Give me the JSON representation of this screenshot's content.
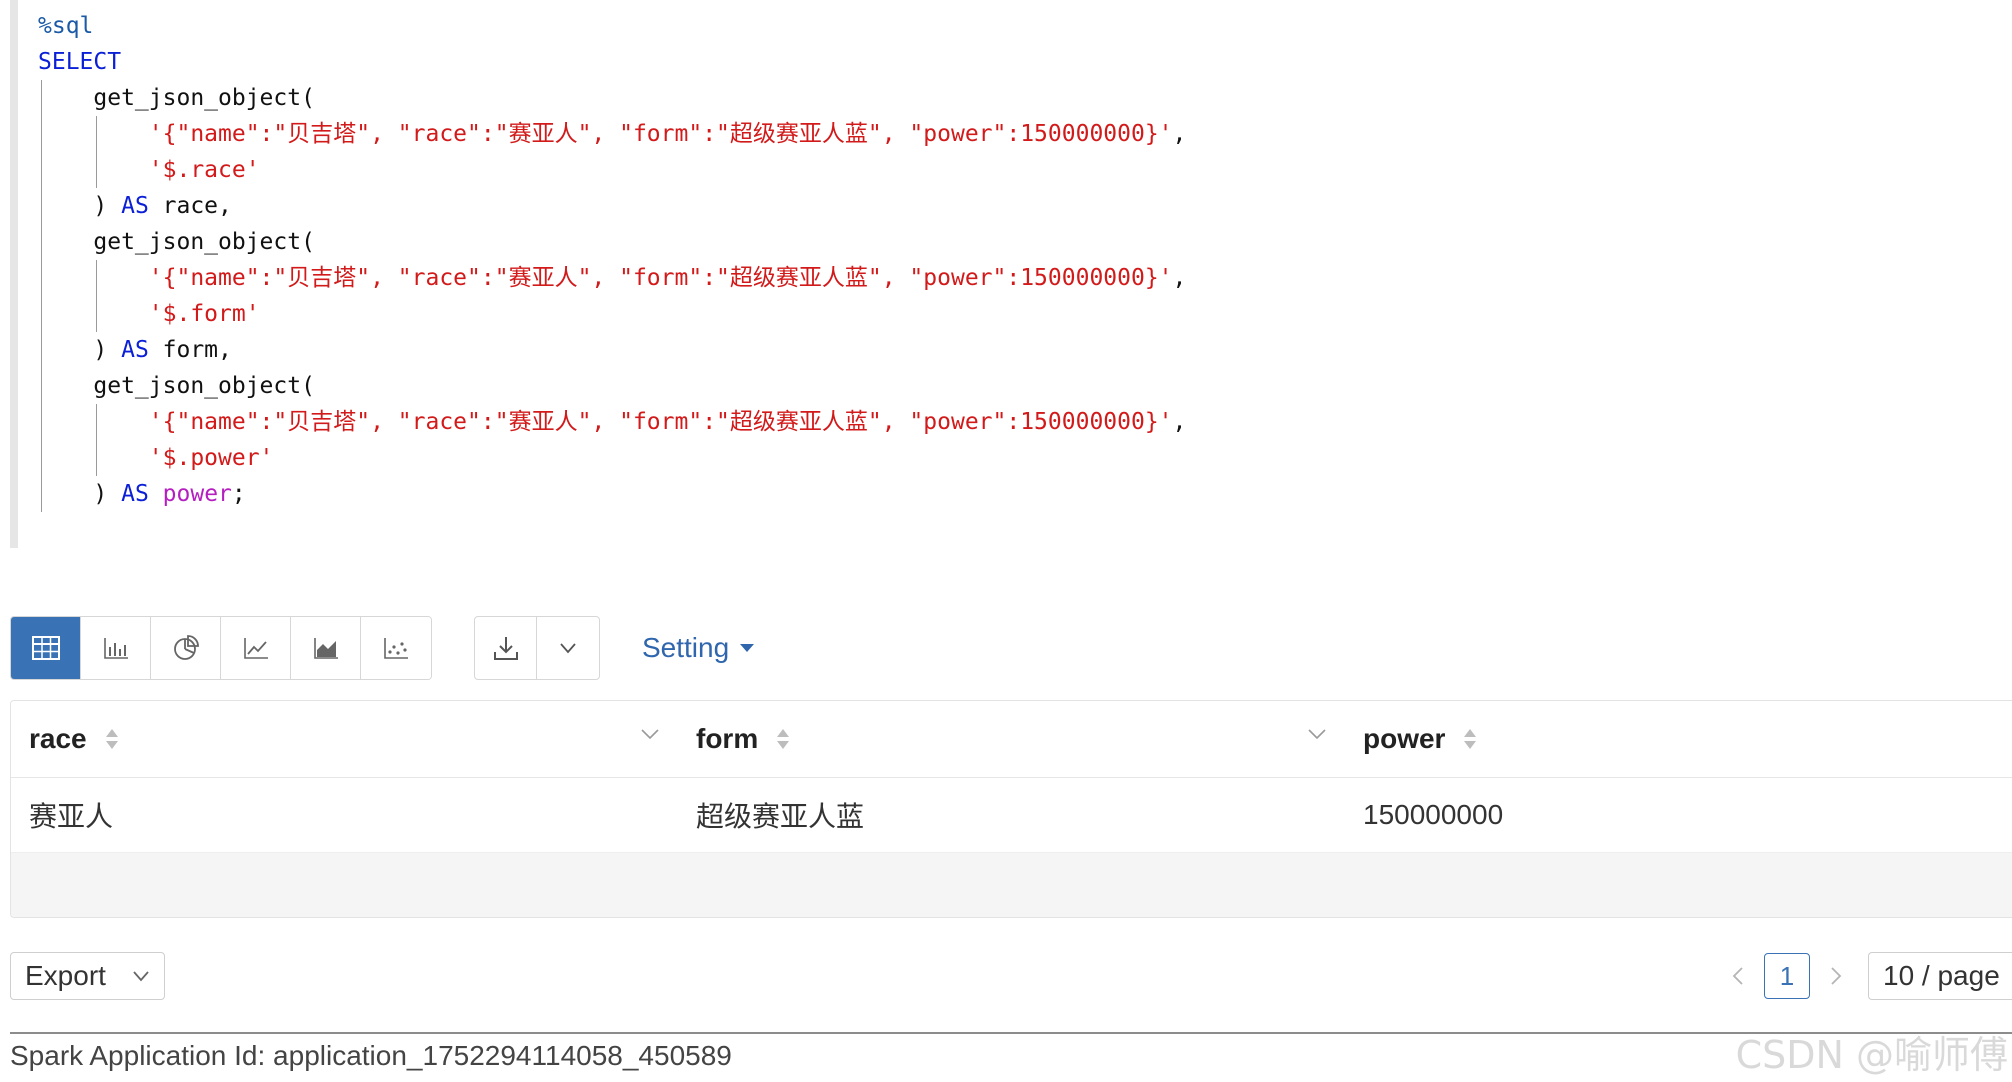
{
  "editor": {
    "lines": [
      [
        {
          "t": "magic",
          "v": "%sql"
        }
      ],
      [
        {
          "t": "kw",
          "v": "SELECT"
        }
      ],
      [
        {
          "t": "plain",
          "v": "    get_json_object("
        }
      ],
      [
        {
          "t": "plain",
          "v": "        "
        },
        {
          "t": "str",
          "v": "'{\"name\":\"贝吉塔\", \"race\":\"赛亚人\", \"form\":\"超级赛亚人蓝\", \"power\":150000000}'"
        },
        {
          "t": "plain",
          "v": ","
        }
      ],
      [
        {
          "t": "plain",
          "v": "        "
        },
        {
          "t": "str",
          "v": "'$.race'"
        }
      ],
      [
        {
          "t": "plain",
          "v": "    ) "
        },
        {
          "t": "kw",
          "v": "AS"
        },
        {
          "t": "plain",
          "v": " race,"
        }
      ],
      [
        {
          "t": "plain",
          "v": "    get_json_object("
        }
      ],
      [
        {
          "t": "plain",
          "v": "        "
        },
        {
          "t": "str",
          "v": "'{\"name\":\"贝吉塔\", \"race\":\"赛亚人\", \"form\":\"超级赛亚人蓝\", \"power\":150000000}'"
        },
        {
          "t": "plain",
          "v": ","
        }
      ],
      [
        {
          "t": "plain",
          "v": "        "
        },
        {
          "t": "str",
          "v": "'$.form'"
        }
      ],
      [
        {
          "t": "plain",
          "v": "    ) "
        },
        {
          "t": "kw",
          "v": "AS"
        },
        {
          "t": "plain",
          "v": " form,"
        }
      ],
      [
        {
          "t": "plain",
          "v": "    get_json_object("
        }
      ],
      [
        {
          "t": "plain",
          "v": "        "
        },
        {
          "t": "str",
          "v": "'{\"name\":\"贝吉塔\", \"race\":\"赛亚人\", \"form\":\"超级赛亚人蓝\", \"power\":150000000}'"
        },
        {
          "t": "plain",
          "v": ","
        }
      ],
      [
        {
          "t": "plain",
          "v": "        "
        },
        {
          "t": "str",
          "v": "'$.power'"
        }
      ],
      [
        {
          "t": "plain",
          "v": "    ) "
        },
        {
          "t": "kw",
          "v": "AS"
        },
        {
          "t": "plain",
          "v": " "
        },
        {
          "t": "fn",
          "v": "power"
        },
        {
          "t": "plain",
          "v": ";"
        }
      ]
    ]
  },
  "toolbar": {
    "views": [
      "table-icon",
      "bar-chart-icon",
      "pie-chart-icon",
      "line-chart-icon",
      "area-chart-icon",
      "scatter-chart-icon"
    ],
    "active_view": "table-icon",
    "download_icon": "download-icon",
    "dropdown_icon": "chevron-down-icon",
    "setting_label": "Setting"
  },
  "table": {
    "columns": [
      "race",
      "form",
      "power"
    ],
    "rows": [
      [
        "赛亚人",
        "超级赛亚人蓝",
        "150000000"
      ]
    ]
  },
  "footer": {
    "export_label": "Export",
    "current_page": "1",
    "page_size": "10 / page",
    "app_id": "Spark Application Id: application_1752294114058_450589",
    "watermark": "CSDN @喻师傅"
  },
  "colors": {
    "accent": "#3a72b6",
    "keyword": "#0a1fd6",
    "string": "#d21a1a",
    "builtin": "#b51ec0"
  }
}
